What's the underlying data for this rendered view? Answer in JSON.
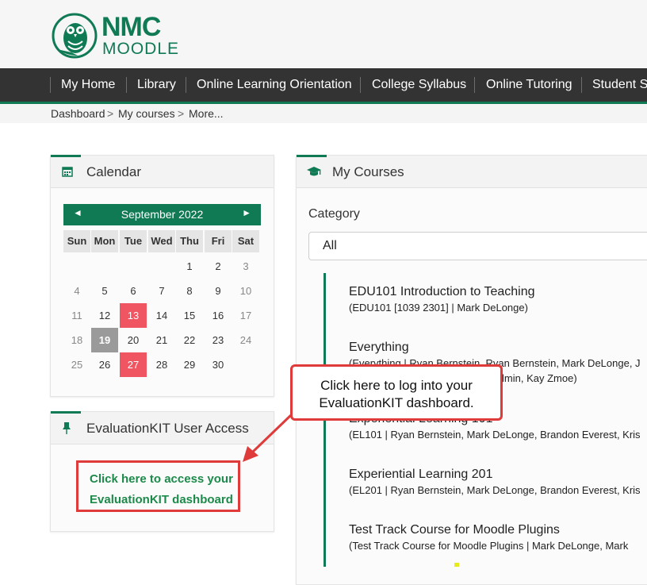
{
  "brand": {
    "line1": "NMC",
    "line2": "MOODLE",
    "color": "#0f7a54"
  },
  "nav": {
    "items": [
      "My Home",
      "Library",
      "Online Learning Orientation",
      "College Syllabus",
      "Online Tutoring",
      "Student S"
    ]
  },
  "breadcrumb": {
    "items": [
      "Dashboard",
      "My courses",
      "More..."
    ],
    "separator": ">"
  },
  "calendar": {
    "title": "Calendar",
    "icon": "calendar-icon",
    "month": "September 2022",
    "prev": "◄",
    "next": "►",
    "weekdays": [
      "Sun",
      "Mon",
      "Tue",
      "Wed",
      "Thu",
      "Fri",
      "Sat"
    ],
    "days": [
      "1",
      "2",
      "3",
      "4",
      "5",
      "6",
      "7",
      "8",
      "9",
      "10",
      "11",
      "12",
      "13",
      "14",
      "15",
      "16",
      "17",
      "18",
      "19",
      "20",
      "21",
      "22",
      "23",
      "24",
      "25",
      "26",
      "27",
      "28",
      "29",
      "30"
    ],
    "event_days": [
      "13",
      "27"
    ],
    "today": "19"
  },
  "evaluationkit": {
    "title": "EvaluationKIT User Access",
    "icon": "pin-icon",
    "link_line1": "Click here to access your",
    "link_line2": "EvaluationKIT dashboard"
  },
  "my_courses": {
    "title": "My Courses",
    "icon": "graduation-cap-icon",
    "category_label": "Category",
    "category_value": "All",
    "courses": [
      {
        "name": "EDU101 Introduction to Teaching",
        "meta": "(EDU101 [1039 2301]  |  Mark DeLonge)"
      },
      {
        "name": "Everything",
        "meta": "(Everything  |  Ryan Bernstein, Ryan Bernstein, Mark DeLonge, J",
        "meta2": "Admin, Kay Zmoe)"
      },
      {
        "name": "Experiential Learning 101",
        "meta": "(EL101  |  Ryan Bernstein, Mark DeLonge, Brandon Everest, Kris"
      },
      {
        "name": "Experiential Learning 201",
        "meta": "(EL201  |  Ryan Bernstein, Mark DeLonge, Brandon Everest, Kris"
      },
      {
        "name": "Test Track Course for Moodle Plugins",
        "meta": "(Test Track Course for Moodle Plugins  |  Mark DeLonge, Mark"
      }
    ]
  },
  "callout": {
    "line1": "Click here to log into your",
    "line2": "EvaluationKIT dashboard."
  },
  "colors": {
    "accent": "#0f7a54",
    "event": "#f05562",
    "highlight": "#e03b3b"
  }
}
